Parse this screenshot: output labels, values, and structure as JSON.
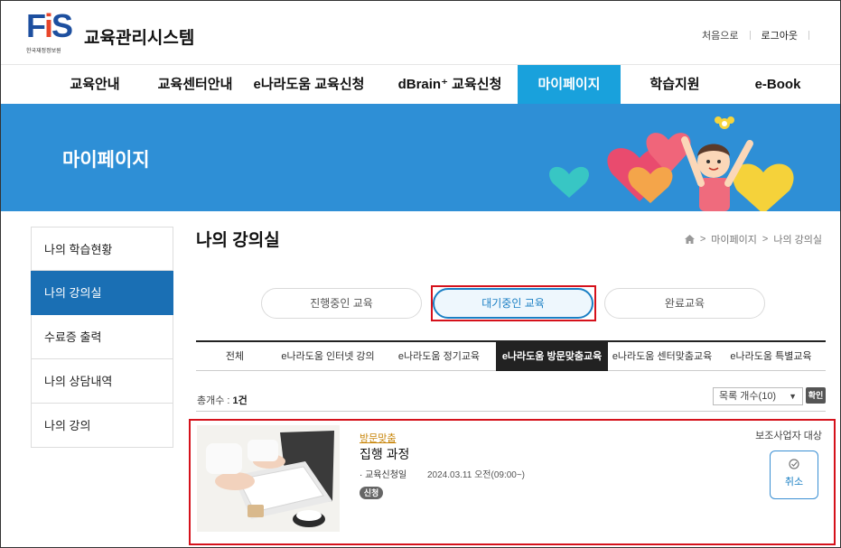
{
  "header": {
    "logo_text": "FiS",
    "logo_sub": "한국재정정보원",
    "site_title": "교육관리시스템",
    "links": [
      "처음으로",
      "로그아웃"
    ]
  },
  "nav": {
    "items": [
      "교육안내",
      "교육센터안내",
      "e나라도움 교육신청",
      "dBrain⁺ 교육신청",
      "마이페이지",
      "학습지원",
      "e-Book"
    ],
    "active_index": 4
  },
  "banner": {
    "title": "마이페이지"
  },
  "sidebar": {
    "items": [
      "나의 학습현황",
      "나의 강의실",
      "수료증 출력",
      "나의 상담내역",
      "나의 강의"
    ],
    "active_index": 1
  },
  "page": {
    "title": "나의 강의실",
    "breadcrumb": [
      "마이페이지",
      "나의 강의실"
    ]
  },
  "status_tabs": {
    "items": [
      "진행중인 교육",
      "대기중인 교육",
      "완료교육"
    ],
    "active_index": 1
  },
  "category_tabs": {
    "items": [
      "전체",
      "e나라도움 인터넷 강의",
      "e나라도움 정기교육",
      "e나라도움 방문맞춤교육",
      "e나라도움 센터맞춤교육",
      "e나라도움 특별교육"
    ],
    "active_index": 3
  },
  "list": {
    "count_label": "총개수 : ",
    "count_value": "1건",
    "page_size_select": "목록 개수(10)",
    "confirm_label": "확인"
  },
  "course": {
    "tag": "방문맞춤",
    "title": "집행 과정",
    "date_label": "· 교육신청일",
    "date_value": "2024.03.11 오전(09:00~)",
    "badge": "신청",
    "target": "보조사업자 대상",
    "cancel_label": "취소"
  },
  "colors": {
    "primary_blue": "#19a1dc",
    "sidebar_active": "#1a6fb4",
    "banner": "#2e8fd6",
    "highlight_red": "#d5111b"
  }
}
